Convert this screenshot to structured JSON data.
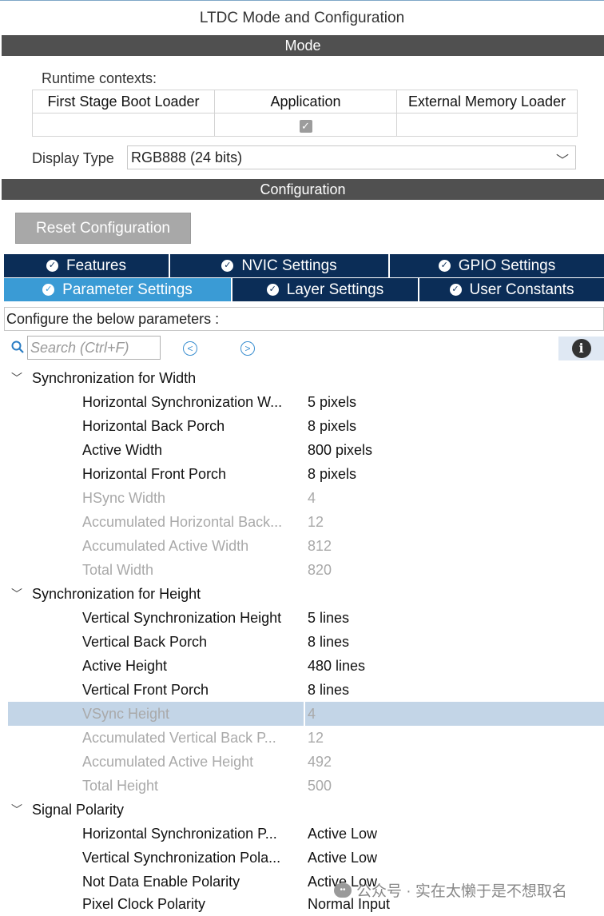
{
  "window": {
    "title": "LTDC Mode and Configuration"
  },
  "mode": {
    "header": "Mode",
    "runtime_label": "Runtime contexts:",
    "contexts": [
      {
        "label": "First Stage Boot Loader",
        "checked": false
      },
      {
        "label": "Application",
        "checked": true
      },
      {
        "label": "External Memory Loader",
        "checked": false
      }
    ],
    "display_type_label": "Display Type",
    "display_type_value": "RGB888 (24 bits)"
  },
  "config": {
    "header": "Configuration",
    "reset_label": "Reset Configuration",
    "tabs_top": [
      "Features",
      "NVIC Settings",
      "GPIO Settings"
    ],
    "tabs_bottom": [
      "Parameter Settings",
      "Layer Settings",
      "User Constants"
    ],
    "active_tab": "Parameter Settings",
    "params_caption": "Configure the below parameters :",
    "search_placeholder": "Search (Ctrl+F)"
  },
  "groups": [
    {
      "name": "Synchronization for Width",
      "params": [
        {
          "name": "Horizontal Synchronization W...",
          "value": "5 pixels",
          "disabled": false
        },
        {
          "name": "Horizontal Back Porch",
          "value": "8 pixels",
          "disabled": false
        },
        {
          "name": "Active Width",
          "value": "800 pixels",
          "disabled": false
        },
        {
          "name": "Horizontal Front Porch",
          "value": "8 pixels",
          "disabled": false
        },
        {
          "name": "HSync Width",
          "value": "4",
          "disabled": true
        },
        {
          "name": "Accumulated Horizontal Back...",
          "value": "12",
          "disabled": true
        },
        {
          "name": "Accumulated Active Width",
          "value": "812",
          "disabled": true
        },
        {
          "name": "Total Width",
          "value": "820",
          "disabled": true
        }
      ]
    },
    {
      "name": "Synchronization for Height",
      "params": [
        {
          "name": "Vertical Synchronization Height",
          "value": "5 lines",
          "disabled": false
        },
        {
          "name": "Vertical Back Porch",
          "value": "8 lines",
          "disabled": false
        },
        {
          "name": "Active Height",
          "value": "480 lines",
          "disabled": false
        },
        {
          "name": "Vertical Front Porch",
          "value": "8 lines",
          "disabled": false
        },
        {
          "name": "VSync Height",
          "value": "4",
          "disabled": true,
          "selected": true
        },
        {
          "name": "Accumulated Vertical Back P...",
          "value": "12",
          "disabled": true
        },
        {
          "name": "Accumulated Active Height",
          "value": "492",
          "disabled": true
        },
        {
          "name": "Total Height",
          "value": "500",
          "disabled": true
        }
      ]
    },
    {
      "name": "Signal Polarity",
      "params": [
        {
          "name": "Horizontal Synchronization P...",
          "value": "Active Low",
          "disabled": false
        },
        {
          "name": "Vertical Synchronization Pola...",
          "value": "Active Low",
          "disabled": false
        },
        {
          "name": "Not Data Enable Polarity",
          "value": "Active Low",
          "disabled": false
        },
        {
          "name": "Pixel Clock Polarity",
          "value": "Normal Input",
          "disabled": false
        }
      ]
    }
  ],
  "watermark": "公众号 · 实在太懒于是不想取名"
}
